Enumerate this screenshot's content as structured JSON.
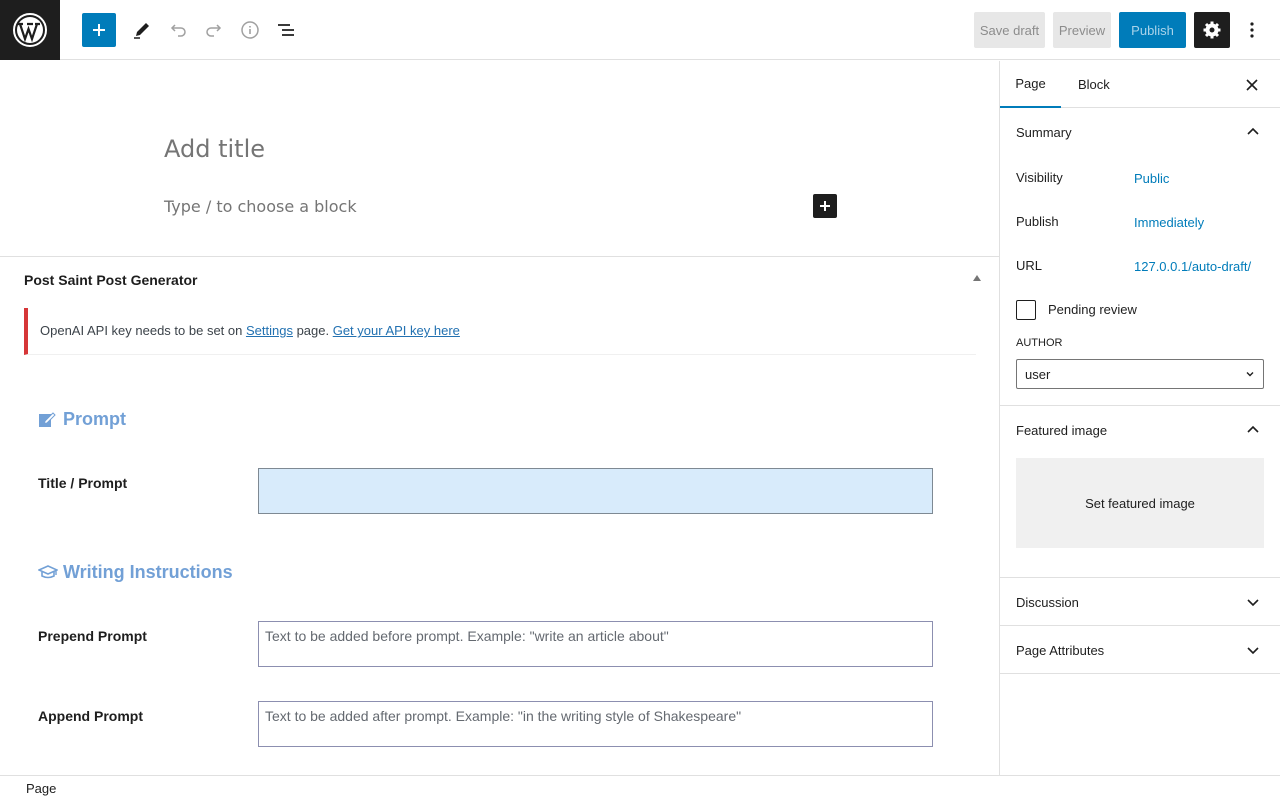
{
  "toolbar": {
    "save_draft": "Save draft",
    "preview": "Preview",
    "publish": "Publish",
    "icons": [
      "wordpress-logo",
      "plus-icon",
      "pencil-icon",
      "undo-icon",
      "redo-icon",
      "info-icon",
      "list-view-icon",
      "gear-icon",
      "more-vertical-icon"
    ]
  },
  "editor": {
    "title_placeholder": "Add title",
    "block_placeholder": "Type / to choose a block"
  },
  "metabox": {
    "title": "Post Saint Post Generator",
    "notice": {
      "text_before": "OpenAI API key needs to be set on ",
      "settings_link": "Settings",
      "text_middle": " page. ",
      "api_link": "Get your API key here"
    },
    "prompt_section": {
      "heading": "Prompt",
      "title_prompt_label": "Title / Prompt",
      "title_prompt_value": ""
    },
    "writing_section": {
      "heading": "Writing Instructions",
      "prepend_label": "Prepend Prompt",
      "prepend_placeholder": "Text to be added before prompt. Example: \"write an article about\"",
      "append_label": "Append Prompt",
      "append_placeholder": "Text to be added after prompt. Example: \"in the writing style of Shakespeare\""
    }
  },
  "footer": {
    "breadcrumb": "Page"
  },
  "sidebar": {
    "tabs": [
      "Page",
      "Block"
    ],
    "summary": {
      "title": "Summary",
      "visibility_label": "Visibility",
      "visibility_value": "Public",
      "publish_label": "Publish",
      "publish_value": "Immediately",
      "url_label": "URL",
      "url_value": "127.0.0.1/auto-draft/",
      "pending_review": "Pending review",
      "author_label": "AUTHOR",
      "author_value": "user"
    },
    "featured_image": {
      "title": "Featured image",
      "button": "Set featured image"
    },
    "discussion": "Discussion",
    "page_attributes": "Page Attributes"
  },
  "colors": {
    "accent": "#007cba",
    "notice_error": "#d63638",
    "heading_blue": "#72a0d6"
  }
}
